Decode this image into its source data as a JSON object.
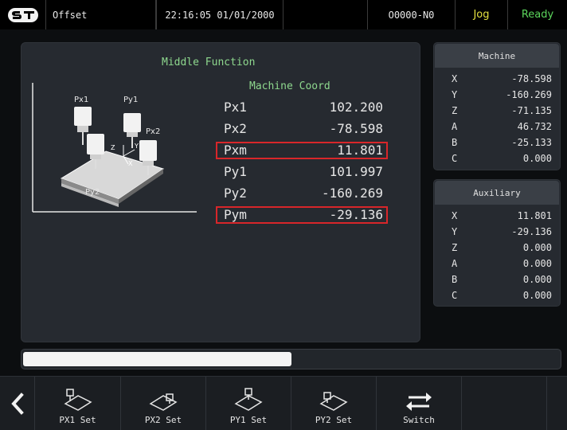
{
  "topbar": {
    "logo_text": "ST",
    "screen_title": "Offset",
    "clock": "22:16:05 01/01/2000",
    "program": "O0000-N0",
    "mode": "Jog",
    "state": "Ready"
  },
  "main": {
    "title": "Middle Function",
    "coord_header": "Machine Coord",
    "diagram": {
      "labels": {
        "px1": "Px1",
        "py1": "Py1",
        "px2": "Px2",
        "py2": "Py2",
        "axis_z": "Z",
        "axis_y": "Y",
        "axis_x": "X"
      }
    },
    "rows": [
      {
        "label": "Px1",
        "value": "102.200",
        "highlight": false
      },
      {
        "label": "Px2",
        "value": "-78.598",
        "highlight": false
      },
      {
        "label": "Pxm",
        "value": "11.801",
        "highlight": true
      },
      {
        "label": "Py1",
        "value": "101.997",
        "highlight": false
      },
      {
        "label": "Py2",
        "value": "-160.269",
        "highlight": false
      },
      {
        "label": "Pym",
        "value": "-29.136",
        "highlight": true
      }
    ]
  },
  "machine": {
    "title": "Machine",
    "axes": [
      {
        "name": "X",
        "value": "-78.598"
      },
      {
        "name": "Y",
        "value": "-160.269"
      },
      {
        "name": "Z",
        "value": "-71.135"
      },
      {
        "name": "A",
        "value": "46.732"
      },
      {
        "name": "B",
        "value": "-25.133"
      },
      {
        "name": "C",
        "value": "0.000"
      }
    ]
  },
  "auxiliary": {
    "title": "Auxiliary",
    "axes": [
      {
        "name": "X",
        "value": "11.801"
      },
      {
        "name": "Y",
        "value": "-29.136"
      },
      {
        "name": "Z",
        "value": "0.000"
      },
      {
        "name": "A",
        "value": "0.000"
      },
      {
        "name": "B",
        "value": "0.000"
      },
      {
        "name": "C",
        "value": "0.000"
      }
    ]
  },
  "progress": {
    "fraction": 0.5
  },
  "toolbar": {
    "back_icon": "chevron-left-icon",
    "buttons": [
      {
        "label": "PX1 Set",
        "icon": "probe-px1-icon"
      },
      {
        "label": "PX2 Set",
        "icon": "probe-px2-icon"
      },
      {
        "label": "PY1 Set",
        "icon": "probe-py1-icon"
      },
      {
        "label": "PY2 Set",
        "icon": "probe-py2-icon"
      },
      {
        "label": "Switch",
        "icon": "switch-arrows-icon"
      },
      {
        "label": "",
        "icon": ""
      }
    ]
  },
  "colors": {
    "accent_green": "#8ed88e",
    "mode_yellow": "#e4e040",
    "ready_green": "#5cd65c",
    "highlight_red": "#d8262a"
  }
}
